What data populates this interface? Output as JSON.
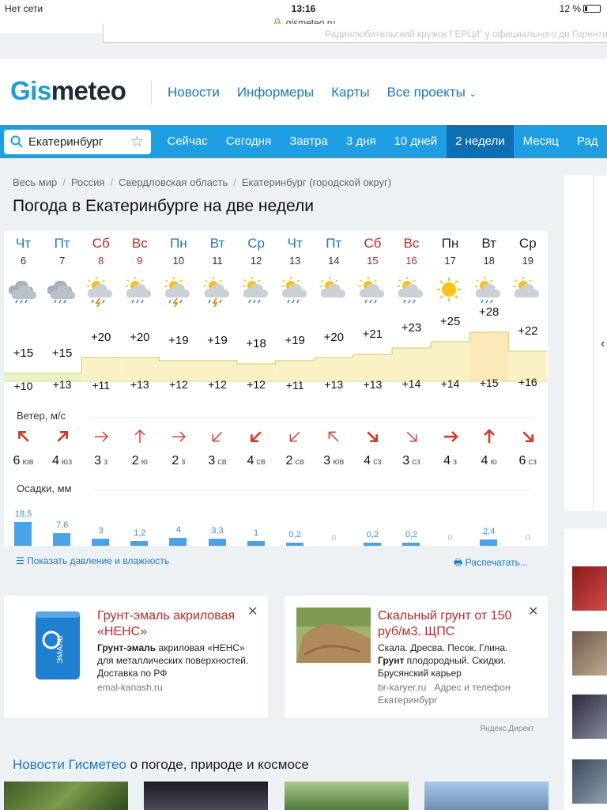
{
  "status": {
    "network": "Нет сети",
    "time": "13:16",
    "battery": "12 %",
    "url": "gismeteo.ru"
  },
  "ghost_text": "Радиолюбительский кружок ГЕРЦ/Г у официального ди Горенти",
  "logo": {
    "part1": "Gis",
    "part2": "meteo"
  },
  "top_nav": [
    "Новости",
    "Информеры",
    "Карты",
    "Все проекты"
  ],
  "search": {
    "value": "Екатеринбург"
  },
  "tabs": [
    "Сейчас",
    "Сегодня",
    "Завтра",
    "3 дня",
    "10 дней",
    "2 недели",
    "Месяц",
    "Рад"
  ],
  "active_tab": "2 недели",
  "breadcrumbs": [
    "Весь мир",
    "Россия",
    "Свердловская область",
    "Екатеринбург (городской округ)"
  ],
  "title": "Погода в Екатеринбурге на две недели",
  "forecast": {
    "days": [
      {
        "name": "Чт",
        "date": "6",
        "kind": "normal",
        "icon": "cloud-rain-icon",
        "tmax": "+15",
        "tmin": "+10",
        "wind": "6",
        "dir": "юв",
        "arrow": "arrow-up-left-icon",
        "bold": true,
        "precip": "18,5"
      },
      {
        "name": "Пт",
        "date": "7",
        "kind": "normal",
        "icon": "cloud-rain-icon",
        "tmax": "+15",
        "tmin": "+13",
        "wind": "4",
        "dir": "юз",
        "arrow": "arrow-up-right-icon",
        "bold": true,
        "precip": "7,6"
      },
      {
        "name": "Сб",
        "date": "8",
        "kind": "wknd",
        "icon": "sun-cloud-storm-icon",
        "tmax": "+20",
        "tmin": "+11",
        "wind": "3",
        "dir": "з",
        "arrow": "arrow-right-icon",
        "bold": false,
        "precip": "3"
      },
      {
        "name": "Вс",
        "date": "9",
        "kind": "wknd",
        "icon": "sun-cloud-rain-icon",
        "tmax": "+20",
        "tmin": "+13",
        "wind": "2",
        "dir": "ю",
        "arrow": "arrow-up-icon",
        "bold": false,
        "precip": "1,2"
      },
      {
        "name": "Пн",
        "date": "10",
        "kind": "normal",
        "icon": "sun-cloud-storm-icon",
        "tmax": "+19",
        "tmin": "+12",
        "wind": "2",
        "dir": "з",
        "arrow": "arrow-right-icon",
        "bold": false,
        "precip": "4"
      },
      {
        "name": "Вт",
        "date": "11",
        "kind": "normal",
        "icon": "sun-cloud-storm-icon",
        "tmax": "+19",
        "tmin": "+12",
        "wind": "3",
        "dir": "св",
        "arrow": "arrow-down-left-icon",
        "bold": false,
        "precip": "3,3"
      },
      {
        "name": "Ср",
        "date": "12",
        "kind": "normal",
        "icon": "sun-cloud-rain-icon",
        "tmax": "+18",
        "tmin": "+12",
        "wind": "4",
        "dir": "св",
        "arrow": "arrow-down-left-icon",
        "bold": true,
        "precip": "1"
      },
      {
        "name": "Чт",
        "date": "13",
        "kind": "normal",
        "icon": "sun-cloud-rain-icon",
        "tmax": "+19",
        "tmin": "+11",
        "wind": "2",
        "dir": "св",
        "arrow": "arrow-down-left-icon",
        "bold": false,
        "precip": "0,2"
      },
      {
        "name": "Пт",
        "date": "14",
        "kind": "normal",
        "icon": "sun-cloud-icon",
        "tmax": "+20",
        "tmin": "+13",
        "wind": "3",
        "dir": "юв",
        "arrow": "arrow-up-left-icon",
        "bold": false,
        "precip": "0"
      },
      {
        "name": "Сб",
        "date": "15",
        "kind": "wknd",
        "icon": "sun-cloud-rain-icon",
        "tmax": "+21",
        "tmin": "+13",
        "wind": "4",
        "dir": "сз",
        "arrow": "arrow-down-right-icon",
        "bold": true,
        "precip": "0,2"
      },
      {
        "name": "Вс",
        "date": "16",
        "kind": "wknd",
        "icon": "sun-cloud-rain-icon",
        "tmax": "+23",
        "tmin": "+14",
        "wind": "3",
        "dir": "сз",
        "arrow": "arrow-down-right-icon",
        "bold": false,
        "precip": "0,2"
      },
      {
        "name": "Пн",
        "date": "17",
        "kind": "dark",
        "icon": "sun-icon",
        "tmax": "+25",
        "tmin": "+14",
        "wind": "4",
        "dir": "з",
        "arrow": "arrow-right-icon",
        "bold": true,
        "precip": "0"
      },
      {
        "name": "Вт",
        "date": "18",
        "kind": "dark",
        "icon": "sun-cloud-rain-icon",
        "tmax": "+28",
        "tmin": "+15",
        "wind": "4",
        "dir": "ю",
        "arrow": "arrow-up-icon",
        "bold": true,
        "precip": "2,4"
      },
      {
        "name": "Ср",
        "date": "19",
        "kind": "dark",
        "icon": "sun-cloud-icon",
        "tmax": "+22",
        "tmin": "+16",
        "wind": "6",
        "dir": "сз",
        "arrow": "arrow-down-right-icon",
        "bold": true,
        "precip": "0"
      }
    ],
    "wind_label": "Ветер, м/с",
    "precip_label": "Осадки, мм"
  },
  "links": {
    "show": "Показать давление и влажность",
    "print": "Распечатать..."
  },
  "ads": [
    {
      "title": "Грунт-эмаль акриловая «НЕНС»",
      "body_bold": "Грунт-эмаль",
      "body": " акриловая «НЕНС» для металлических поверхностей. Доставка по РФ",
      "site": "emal-kanash.ru",
      "image": "paint-barrel-image"
    },
    {
      "title": "Скальный грунт от 150 руб/м3. ЩПС",
      "body_a": "Скала. Дресва. Песок. Глина.",
      "body_bold": "Грунт",
      "body_b": " плодородный. Скидки. Брусянский карьер",
      "site": "br-karyer.ru",
      "site_extra": "Адрес и телефон",
      "city": "Екатеринбург",
      "image": "soil-pile-image"
    }
  ],
  "direct": "Яндекс.Директ",
  "news": {
    "blue": "Новости Гисметео",
    "rest": " о погоде, природе и космосе"
  },
  "colors": {
    "accent": "#1e9ee3",
    "active_tab": "#0d6fb1",
    "weekend": "#c62828",
    "link": "#1a7bbf",
    "temp_band": "#fdf6c9",
    "precip": "#4aa3e6"
  }
}
